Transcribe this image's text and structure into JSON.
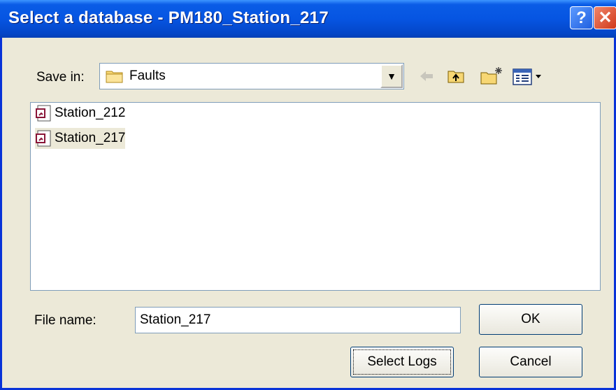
{
  "window": {
    "title": "Select a database - PM180_Station_217"
  },
  "titlebar": {
    "help_label": "?",
    "close_label": "✕"
  },
  "toolbar": {
    "save_in_label": "Save in:",
    "save_in_value": "Faults",
    "icons": [
      "back-arrow-icon",
      "up-folder-icon",
      "new-folder-icon",
      "view-menu-icon"
    ]
  },
  "files": [
    {
      "name": "Station_212",
      "selected": false
    },
    {
      "name": "Station_217",
      "selected": true
    }
  ],
  "form": {
    "file_name_label": "File name:",
    "file_name_value": "Station_217"
  },
  "buttons": {
    "ok": "OK",
    "select_logs": "Select Logs",
    "cancel": "Cancel"
  }
}
